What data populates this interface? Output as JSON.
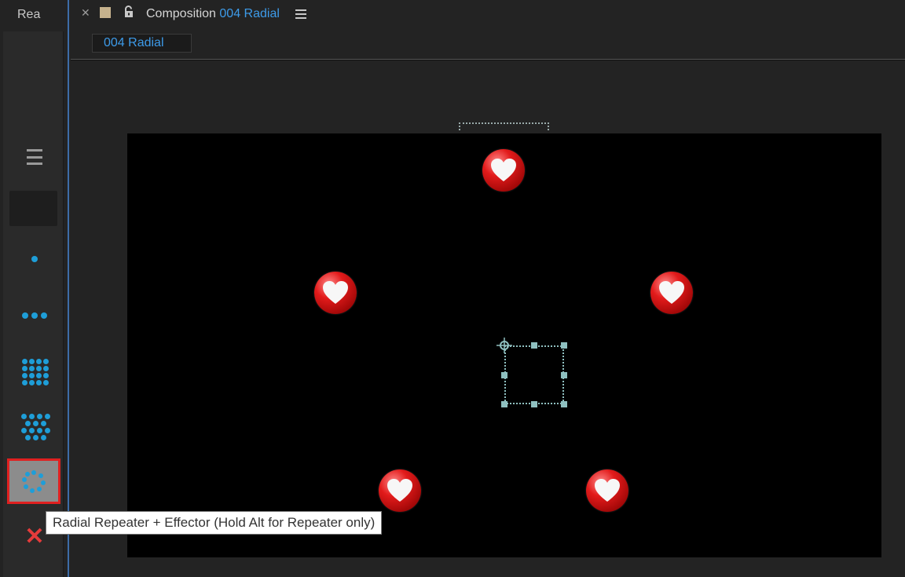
{
  "left_panel": {
    "tab_label": "Rea",
    "tools": [
      {
        "name": "menu",
        "icon": "hamburger-icon"
      },
      {
        "name": "blank",
        "icon": "empty-slot"
      },
      {
        "name": "single",
        "icon": "single-dot-icon"
      },
      {
        "name": "linear",
        "icon": "linear-repeater-icon"
      },
      {
        "name": "grid",
        "icon": "grid-repeater-icon"
      },
      {
        "name": "hex-grid",
        "icon": "hex-grid-repeater-icon"
      },
      {
        "name": "radial",
        "icon": "radial-repeater-icon",
        "selected": true
      },
      {
        "name": "remove",
        "icon": "close-icon"
      }
    ]
  },
  "composition": {
    "prefix": "Composition",
    "name": "004 Radial",
    "tab_label": "004 Radial"
  },
  "tooltip": {
    "text": "Radial Repeater + Effector (Hold Alt for Repeater only)"
  },
  "colors": {
    "accent_blue": "#3d9be9",
    "dot_blue": "#1e9ed8",
    "selection_red": "#e02020",
    "heart_red": "#e21b1b"
  }
}
